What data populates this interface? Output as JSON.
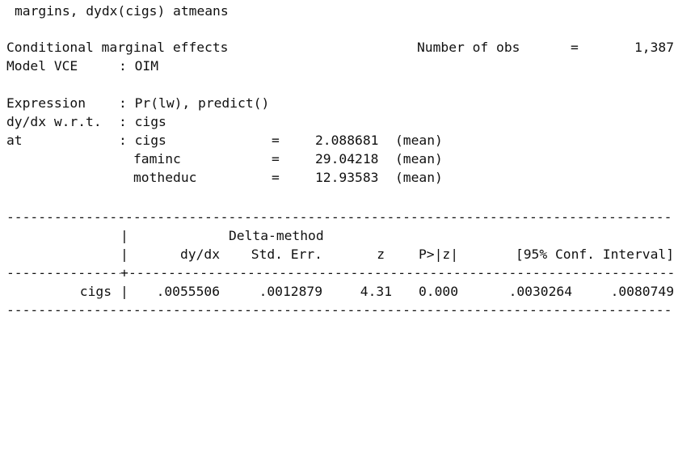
{
  "command": "margins, dydx(cigs) atmeans",
  "header": {
    "title": "Conditional marginal effects",
    "nobs_label": "Number of obs",
    "nobs_eq": "=",
    "nobs_value": "1,387",
    "vce_label": "Model VCE",
    "vce_value": ": OIM"
  },
  "expression": {
    "label": "Expression",
    "value": ": Pr(lw), predict()"
  },
  "dydx_wrt": {
    "label": "dy/dx w.r.t.",
    "value": ": cigs"
  },
  "at": {
    "label": "at",
    "rows": [
      {
        "var": ": cigs",
        "eq": "=",
        "value": "2.088681",
        "note": "(mean)"
      },
      {
        "var": "faminc",
        "eq": "=",
        "value": "29.04218",
        "note": "(mean)"
      },
      {
        "var": "motheduc",
        "eq": "=",
        "value": "12.93583",
        "note": "(mean)"
      }
    ]
  },
  "table": {
    "pipe": "|",
    "cross": "+",
    "header_method": "Delta-method",
    "columns": [
      "dy/dx",
      "Std. Err.",
      "z",
      "P>|z|",
      "[95% Conf. Interval]"
    ],
    "rows": [
      {
        "name": "cigs",
        "dydx": ".0055506",
        "se": ".0012879",
        "z": "4.31",
        "p": "0.000",
        "ci_low": ".0030264",
        "ci_high": ".0080749"
      }
    ]
  }
}
